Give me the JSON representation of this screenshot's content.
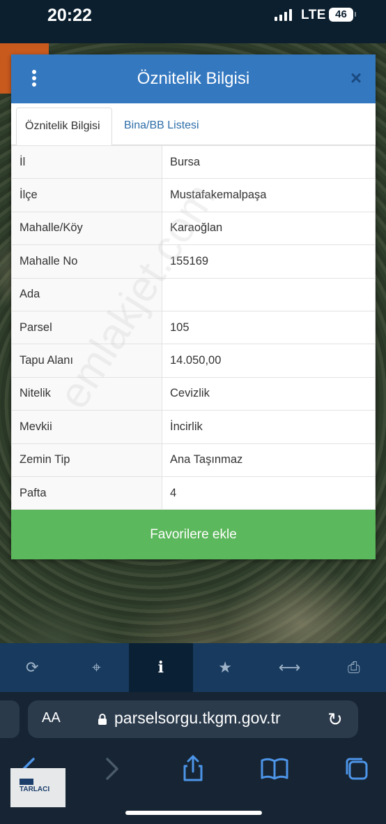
{
  "status_bar": {
    "time": "20:22",
    "network": "LTE",
    "battery": "46"
  },
  "dialog": {
    "title": "Öznitelik Bilgisi",
    "close_symbol": "×",
    "tabs": [
      {
        "label": "Öznitelik Bilgisi",
        "active": true
      },
      {
        "label": "Bina/BB Listesi",
        "active": false
      }
    ],
    "rows": [
      {
        "key": "İl",
        "value": "Bursa"
      },
      {
        "key": "İlçe",
        "value": "Mustafakemalpaşa"
      },
      {
        "key": "Mahalle/Köy",
        "value": "Karaoğlan"
      },
      {
        "key": "Mahalle No",
        "value": "155169"
      },
      {
        "key": "Ada",
        "value": ""
      },
      {
        "key": "Parsel",
        "value": "105"
      },
      {
        "key": "Tapu Alanı",
        "value": "14.050,00"
      },
      {
        "key": "Nitelik",
        "value": "Cevizlik"
      },
      {
        "key": "Mevkii",
        "value": "İncirlik"
      },
      {
        "key": "Zemin Tip",
        "value": "Ana Taşınmaz"
      },
      {
        "key": "Pafta",
        "value": "4"
      }
    ],
    "favorite_button": "Favorilere ekle"
  },
  "watermark": "emlakjet.com",
  "toolbar": {
    "items": [
      {
        "icon": "refresh-icon",
        "glyph": "⟳"
      },
      {
        "icon": "crosshair-icon",
        "glyph": "⌖"
      },
      {
        "icon": "info-icon",
        "glyph": "i",
        "active": true
      },
      {
        "icon": "star-icon",
        "glyph": "★"
      },
      {
        "icon": "measure-icon",
        "glyph": "⟷"
      },
      {
        "icon": "print-icon",
        "glyph": "⎙"
      }
    ]
  },
  "browser": {
    "text_size": "AA",
    "url": "parselsorgu.tkgm.gov.tr",
    "reload_icon": "reload-icon",
    "nav": [
      "back-icon",
      "forward-icon",
      "share-icon",
      "bookmarks-icon",
      "tabs-icon"
    ]
  },
  "logo": {
    "text": "TARLACI"
  },
  "colors": {
    "header": "#3478c0",
    "favorite": "#5cb85c",
    "toolbar": "#173a5e",
    "link": "#2d6da8"
  }
}
